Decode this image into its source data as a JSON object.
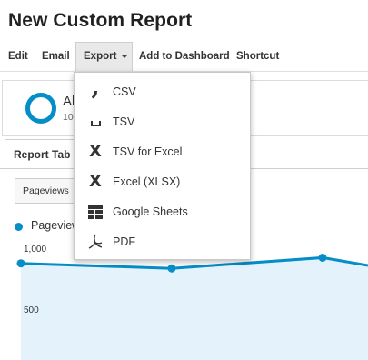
{
  "page": {
    "title": "New Custom Report"
  },
  "toolbar": {
    "edit": "Edit",
    "email": "Email",
    "export": "Export",
    "add_to_dashboard": "Add to Dashboard",
    "shortcut": "Shortcut"
  },
  "segment": {
    "name": "Al",
    "sub": "10"
  },
  "report_tab": {
    "label": "Report Tab"
  },
  "metric_select": {
    "value": "Pageviews"
  },
  "legend": {
    "series_label": "Pageview",
    "color": "#058dc7"
  },
  "export_menu": {
    "items": [
      {
        "label": "CSV",
        "icon": "comma-icon"
      },
      {
        "label": "TSV",
        "icon": "tab-space-icon"
      },
      {
        "label": "TSV for Excel",
        "icon": "excel-x-icon"
      },
      {
        "label": "Excel (XLSX)",
        "icon": "excel-x-icon"
      },
      {
        "label": "Google Sheets",
        "icon": "sheets-grid-icon"
      },
      {
        "label": "PDF",
        "icon": "pdf-icon"
      }
    ]
  },
  "chart_data": {
    "type": "area",
    "series": [
      {
        "name": "Pageviews",
        "values": [
          987,
          946,
          1034,
          970
        ]
      }
    ],
    "yticks": [
      "1,000",
      "500"
    ],
    "ylim": [
      0,
      1500
    ],
    "grid": false,
    "color": "#058dc7",
    "fill": "#e4f2fb"
  }
}
